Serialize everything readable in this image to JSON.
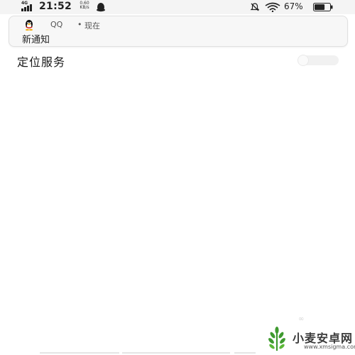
{
  "status_bar": {
    "network_type": "4G",
    "time": "21:52",
    "net_speed_value": "0.60",
    "net_speed_unit": "KB/s",
    "battery_percent": "67%",
    "battery_level": 0.67,
    "icons": [
      "signal-icon",
      "qq-status-icon",
      "mute-icon",
      "wifi-icon",
      "battery-icon"
    ]
  },
  "notification": {
    "app_name": "QQ",
    "separator": "•",
    "time": "现在",
    "message": "新通知",
    "icon": "qq-penguin-icon"
  },
  "settings": {
    "location_label": "定位服务",
    "location_enabled": false
  },
  "watermark": {
    "site_name": "小麦安卓网",
    "site_url": "www.xmsigma.com",
    "logo": "wheat-logo-icon"
  },
  "colors": {
    "background": "#ffffff",
    "status_bar": "#f4f4f4",
    "notification_bg": "#f7f7f7",
    "toggle_off": "#f1f1f1",
    "watermark_green": "#3e9a2f"
  }
}
